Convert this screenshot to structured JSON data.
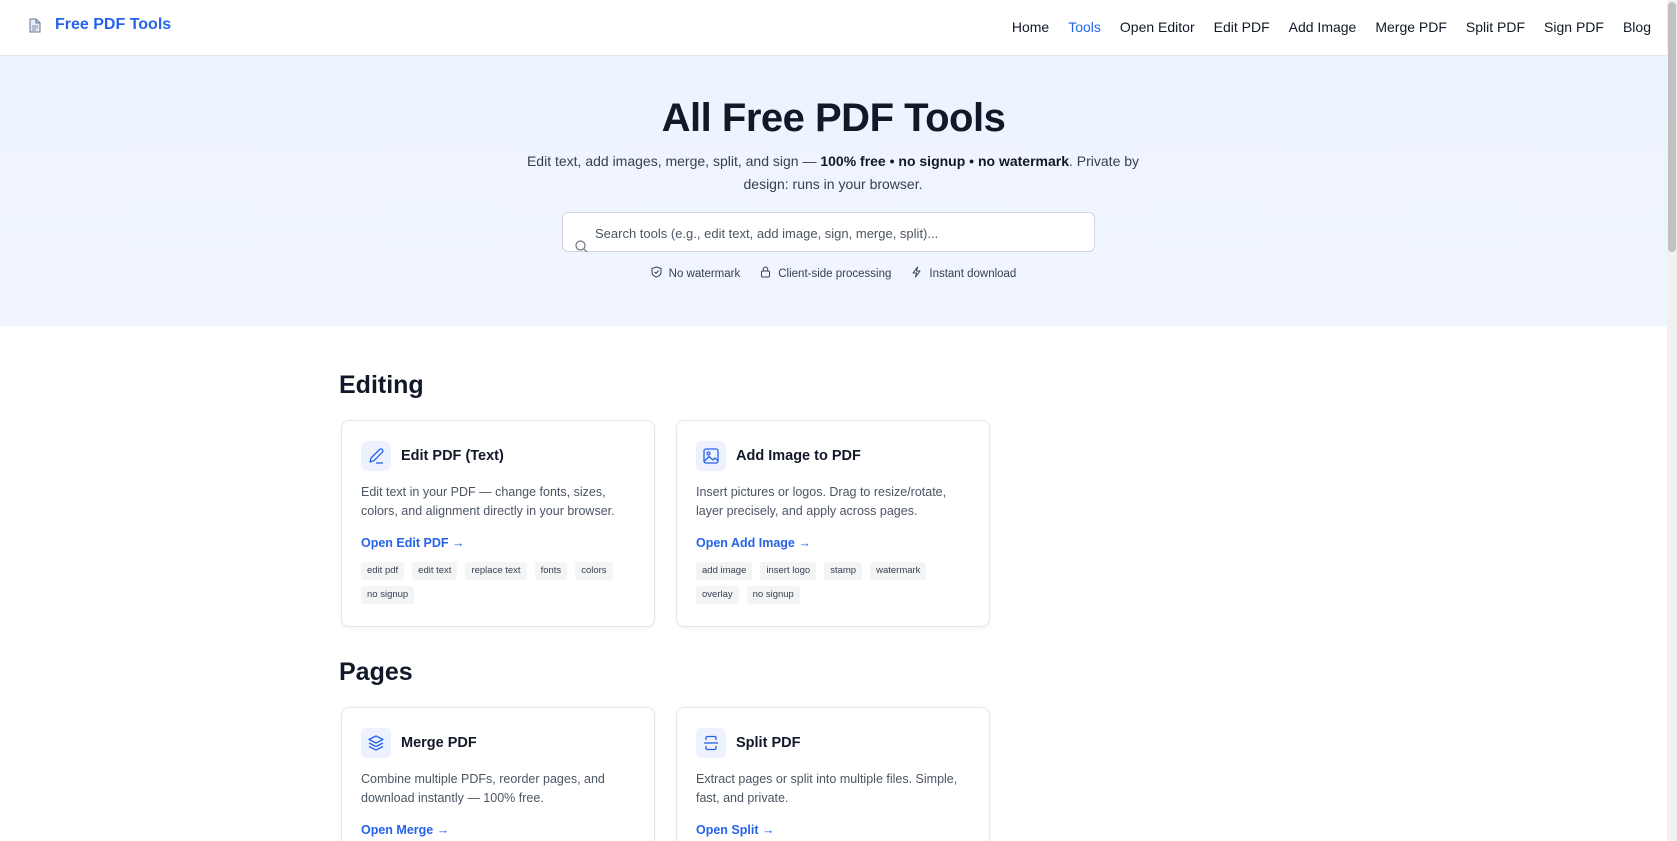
{
  "header": {
    "brand": "Free PDF Tools",
    "nav": [
      "Home",
      "Tools",
      "Open Editor",
      "Edit PDF",
      "Add Image",
      "Merge PDF",
      "Split PDF",
      "Sign PDF",
      "Blog"
    ],
    "active_nav": "Tools"
  },
  "hero": {
    "title": "All Free PDF Tools",
    "subtitle_prefix": "Edit text, add images, merge, split, and sign — ",
    "subtitle_bold": "100% free • no signup • no watermark",
    "subtitle_suffix": ". Private by design: runs in your browser.",
    "search_placeholder": "Search tools (e.g., edit text, add image, sign, merge, split)...",
    "features": [
      {
        "icon": "shield-check-icon",
        "label": "No watermark"
      },
      {
        "icon": "lock-icon",
        "label": "Client-side processing"
      },
      {
        "icon": "bolt-icon",
        "label": "Instant download"
      }
    ]
  },
  "sections": [
    {
      "title": "Editing",
      "cards": [
        {
          "icon": "pencil-icon",
          "title": "Edit PDF (Text)",
          "desc": "Edit text in your PDF — change fonts, sizes, colors, and alignment directly in your browser.",
          "link": "Open Edit PDF →",
          "tags": [
            "edit pdf",
            "edit text",
            "replace text",
            "fonts",
            "colors",
            "no signup"
          ]
        },
        {
          "icon": "image-icon",
          "title": "Add Image to PDF",
          "desc": "Insert pictures or logos. Drag to resize/rotate, layer precisely, and apply across pages.",
          "link": "Open Add Image →",
          "tags": [
            "add image",
            "insert logo",
            "stamp",
            "watermark",
            "overlay",
            "no signup"
          ]
        }
      ]
    },
    {
      "title": "Pages",
      "cards": [
        {
          "icon": "layers-icon",
          "title": "Merge PDF",
          "desc": "Combine multiple PDFs, reorder pages, and download instantly — 100% free.",
          "link": "Open Merge →",
          "tags": []
        },
        {
          "icon": "split-icon",
          "title": "Split PDF",
          "desc": "Extract pages or split into multiple files. Simple, fast, and private.",
          "link": "Open Split →",
          "tags": []
        }
      ]
    }
  ],
  "colors": {
    "accent": "#2563eb",
    "hero_bg": "#eef4ff",
    "text": "#111827",
    "muted": "#4b5563"
  }
}
